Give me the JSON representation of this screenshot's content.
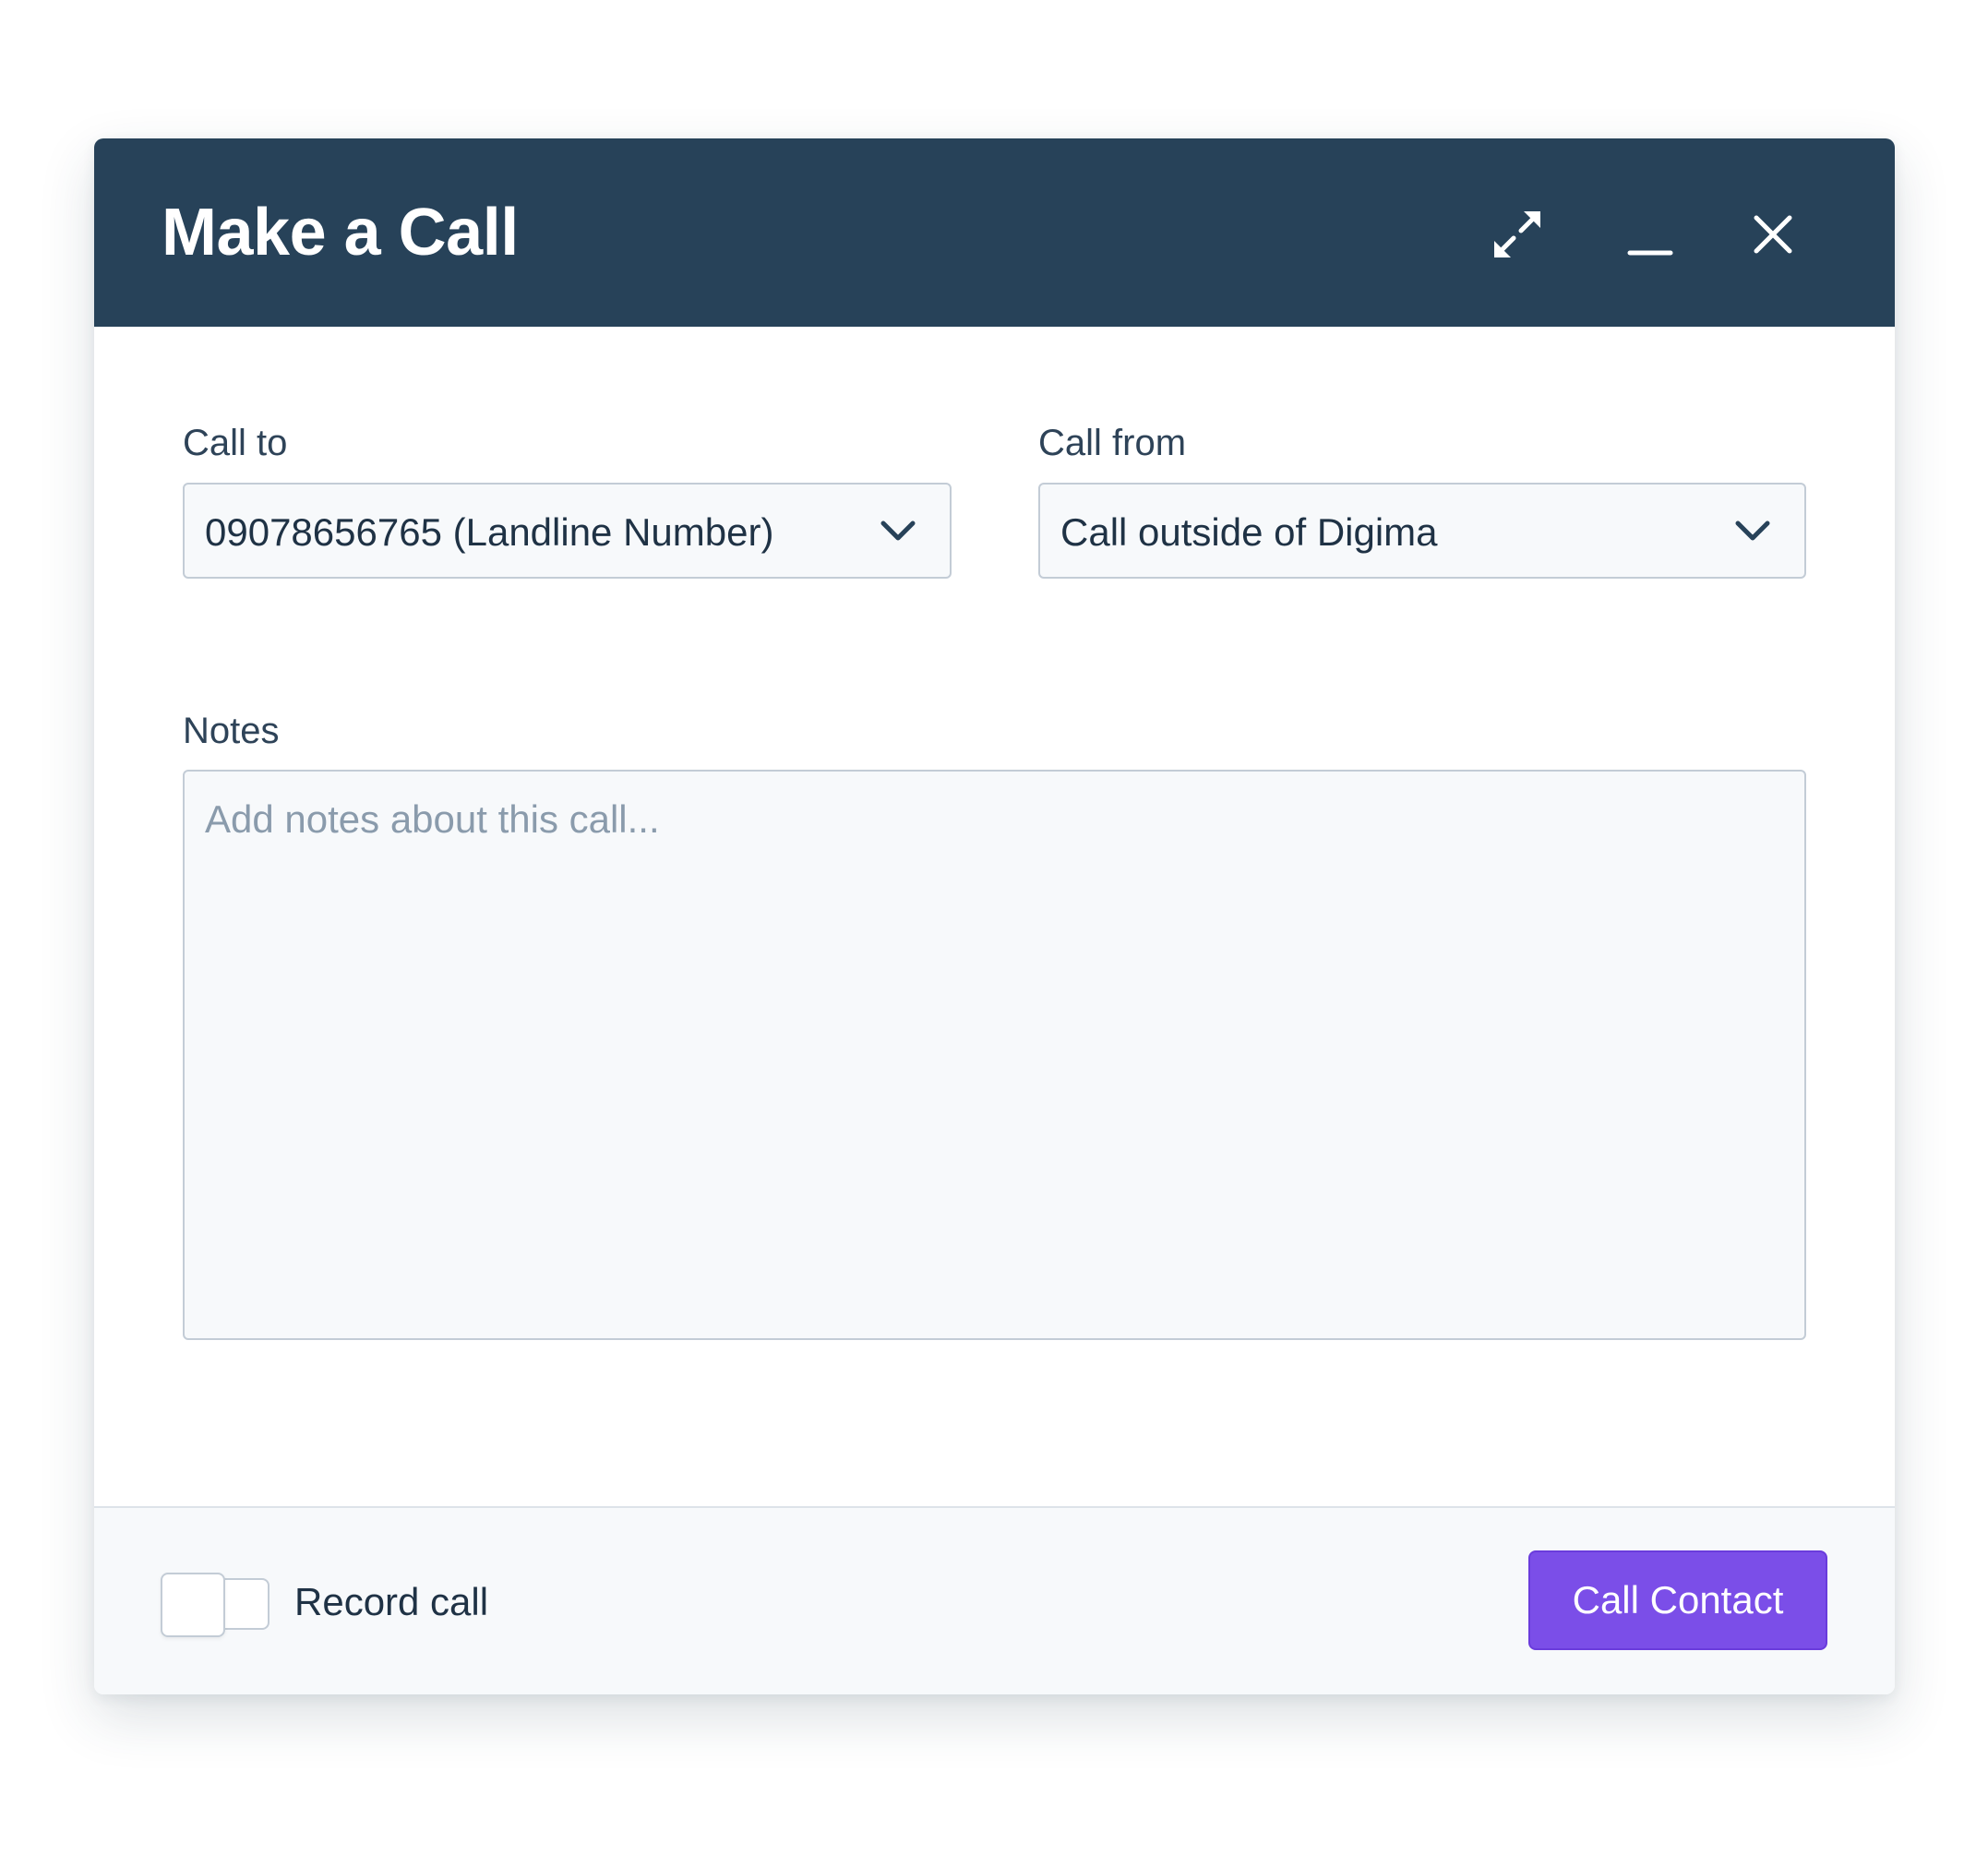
{
  "dialog": {
    "title": "Make a Call",
    "header_icons": [
      "expand-icon",
      "minimize-icon",
      "close-icon"
    ],
    "header_color": "#274259"
  },
  "call_to": {
    "label": "Call to",
    "value": "09078656765 (Landline Number)"
  },
  "call_from": {
    "label": "Call from",
    "value": "Call outside of Digima"
  },
  "notes": {
    "label": "Notes",
    "placeholder": "Add notes about this call..."
  },
  "footer": {
    "record_toggle_label": "Record call",
    "record_toggle_on": false,
    "primary_button_label": "Call Contact",
    "primary_color": "#7b4ee8"
  }
}
